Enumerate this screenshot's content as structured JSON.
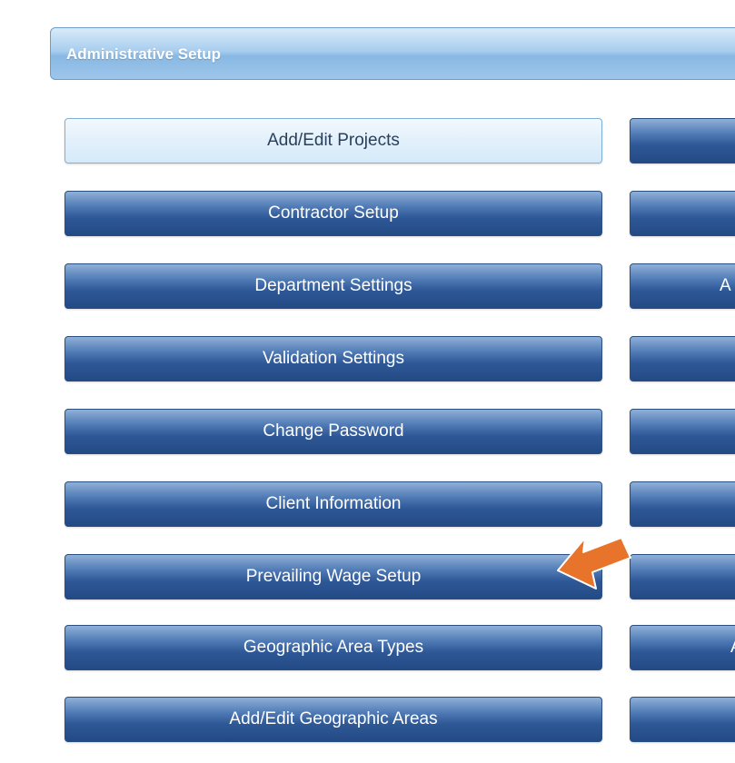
{
  "header": {
    "title": "Administrative Setup"
  },
  "buttons_left": [
    {
      "label": "Add/Edit Projects",
      "active": true
    },
    {
      "label": "Contractor Setup",
      "active": false
    },
    {
      "label": "Department Settings",
      "active": false
    },
    {
      "label": "Validation Settings",
      "active": false
    },
    {
      "label": "Change Password",
      "active": false
    },
    {
      "label": "Client Information",
      "active": false
    },
    {
      "label": "Prevailing Wage Setup",
      "active": false
    },
    {
      "label": "Geographic Area Types",
      "active": false
    },
    {
      "label": "Add/Edit Geographic Areas",
      "active": false
    }
  ],
  "buttons_right_partial": [
    {
      "label": ""
    },
    {
      "label": ""
    },
    {
      "label": "A"
    },
    {
      "label": ""
    },
    {
      "label": ""
    },
    {
      "label": ""
    },
    {
      "label": ""
    },
    {
      "label": "A"
    },
    {
      "label": ""
    }
  ],
  "annotation": {
    "arrow_color": "#e8732a",
    "arrow_border_color": "#ffffff",
    "points_to": "Prevailing Wage Setup"
  },
  "colors": {
    "button_gradient_top": "#8fb0d8",
    "button_gradient_bottom": "#234a85",
    "active_button_bg": "#e2f0fb",
    "header_bg": "#a8cdee"
  }
}
